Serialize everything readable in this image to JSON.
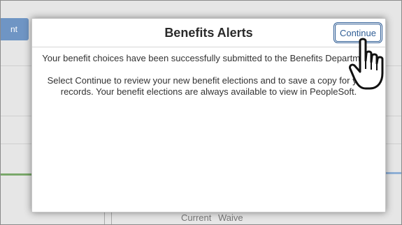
{
  "background": {
    "button_label": "nt",
    "columns_label": "Current  Waive"
  },
  "modal": {
    "title": "Benefits Alerts",
    "continue_label": "Continue",
    "message_1": "Your benefit choices have been successfully submitted to the Benefits Department.",
    "message_2": "Select Continue to review your new benefit elections and to save a copy for your records. Your benefit elections are always available to view in PeopleSoft."
  },
  "icons": {
    "cursor": "hand-pointer-icon"
  }
}
